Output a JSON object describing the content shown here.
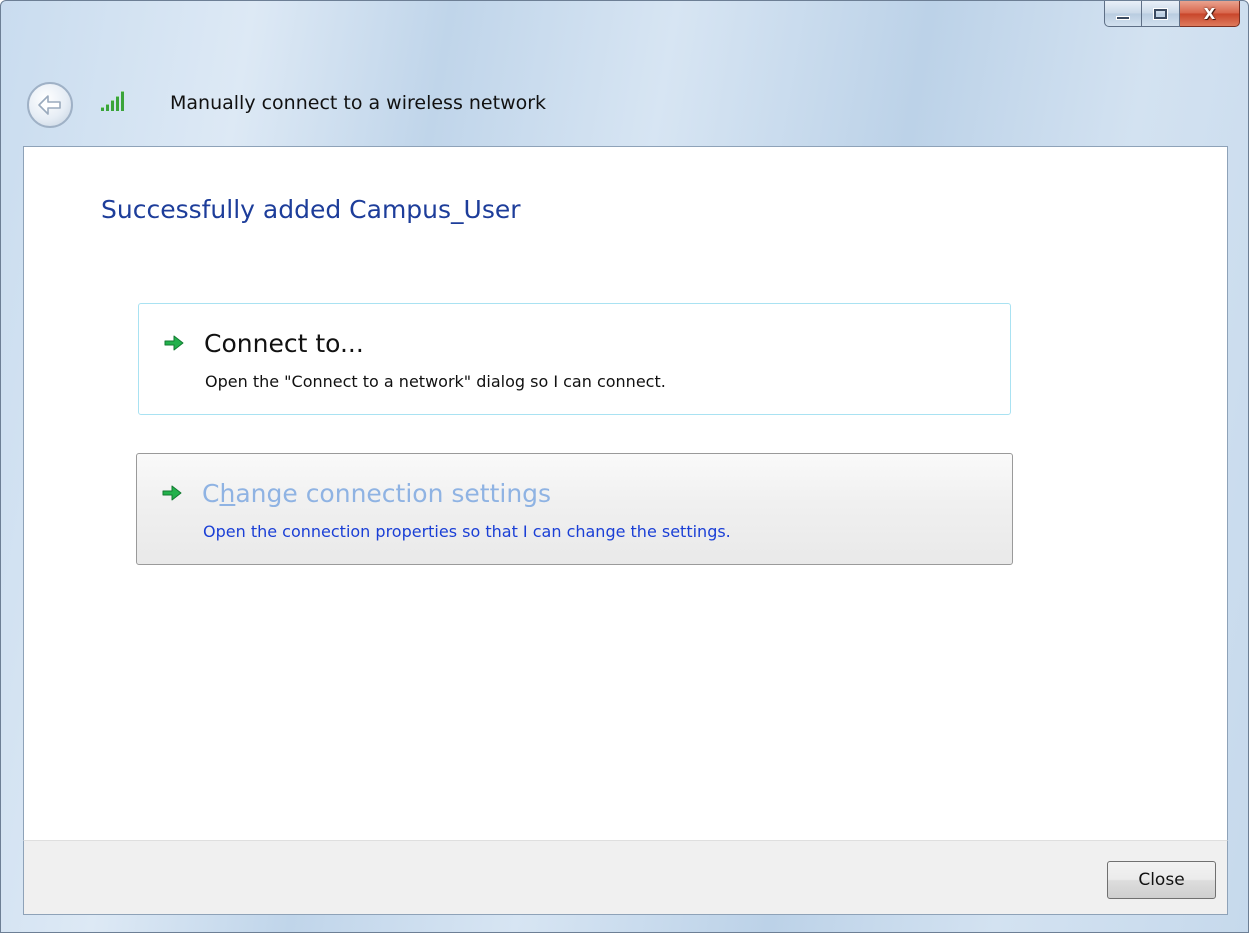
{
  "window": {
    "title": "Manually connect to a wireless network",
    "caption_buttons": {
      "minimize_icon": "minimize-icon",
      "maximize_icon": "maximize-icon",
      "close_glyph": "X"
    }
  },
  "main": {
    "instruction": "Successfully added Campus_User",
    "commands": [
      {
        "title": "Connect to...",
        "description": "Open the \"Connect to a network\" dialog so I can connect.",
        "icon": "green-arrow-icon"
      },
      {
        "title_prefix": "C",
        "title_mnemonic": "h",
        "title_suffix": "ange connection settings",
        "description": "Open the connection properties so that I can change the settings.",
        "icon": "green-arrow-icon"
      }
    ]
  },
  "footer": {
    "close_label": "Close"
  },
  "colors": {
    "instruction": "#1d3d9a",
    "command_hover_title": "#8fb3e3",
    "command_hover_desc": "#1a3fd6",
    "arrow_green": "#22b14c"
  }
}
